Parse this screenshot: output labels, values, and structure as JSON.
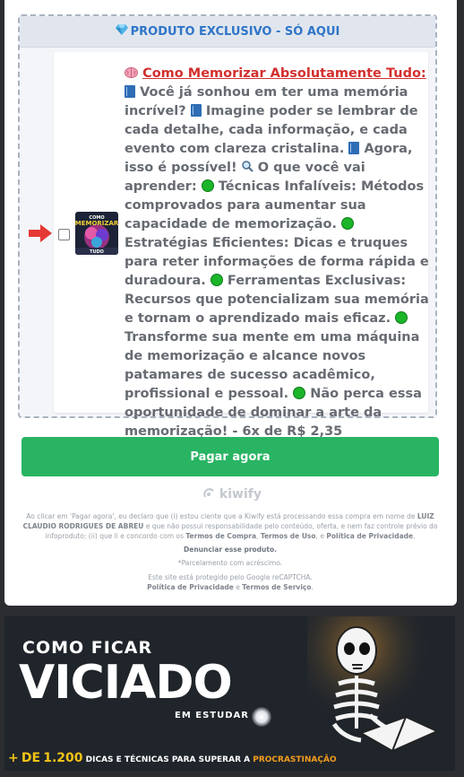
{
  "offer": {
    "header": "PRODUTO EXCLUSIVO - SÓ AQUI",
    "gem_icon": "gem-icon",
    "title": "Como Memorizar Absolutamente Tudo:",
    "p1": "Você já sonhou em ter uma memória incrível?",
    "p2": "Imagine poder se lembrar de cada detalhe, cada informação, e cada evento com clareza cristalina.",
    "p3": "Agora, isso é possível!",
    "p4": "O que você vai aprender:",
    "p5": "Técnicas Infalíveis: Métodos comprovados para aumentar sua capacidade de memorização.",
    "p6": "Estratégias Eficientes: Dicas e truques para reter informações de forma rápida e duradoura.",
    "p7": "Ferramentas Exclusivas: Recursos que potencializam sua memória e tornam o aprendizado mais eficaz.",
    "p8": "Transforme sua mente em uma máquina de memorização e alcance novos patamares de sucesso acadêmico, profissional e pessoal.",
    "p9": "Não perca essa oportunidade de dominar a arte da memorização! - 6x de R$ 2,35",
    "thumb_line1": "COMO",
    "thumb_line2": "MEMORIZAR",
    "thumb_line3": "TUDO"
  },
  "pay_button": "Pagar agora",
  "brand": "kiwify",
  "legal": {
    "t1": "Ao clicar em 'Pagar agora', eu declaro que (i) estou ciente que a Kiwify está processando essa compra em nome de ",
    "seller": "LUIZ CLAUDIO RODRIGUES DE ABREU",
    "t2": " e que não possui responsabilidade pelo conteúdo, oferta, e nem faz controle prévio do infoproduto; (ii) que li e concordo com os ",
    "terms_buy": "Termos de Compra",
    "sep1": ", ",
    "terms_use": "Termos de Uso",
    "sep2": ", e ",
    "privacy": "Política de Privacidade",
    "end": ".",
    "denounce": "Denunciar esse produto.",
    "installments": "*Parcelamento com acréscimo.",
    "recaptcha": "Este site está protegido pelo Google reCAPTCHA.",
    "g_privacy": "Política de Privacidade",
    "and": " e ",
    "g_terms": "Termos de Serviço",
    "dot": "."
  },
  "banner": {
    "line1": "COMO FICAR",
    "line2": "VICIADO",
    "line3": "EM ESTUDAR",
    "plus": "+",
    "de": "DE",
    "count": "1.200",
    "tagline": "DICAS E TÉCNICAS PARA SUPERAR A",
    "highlight": "PROCRASTINAÇÃO"
  }
}
